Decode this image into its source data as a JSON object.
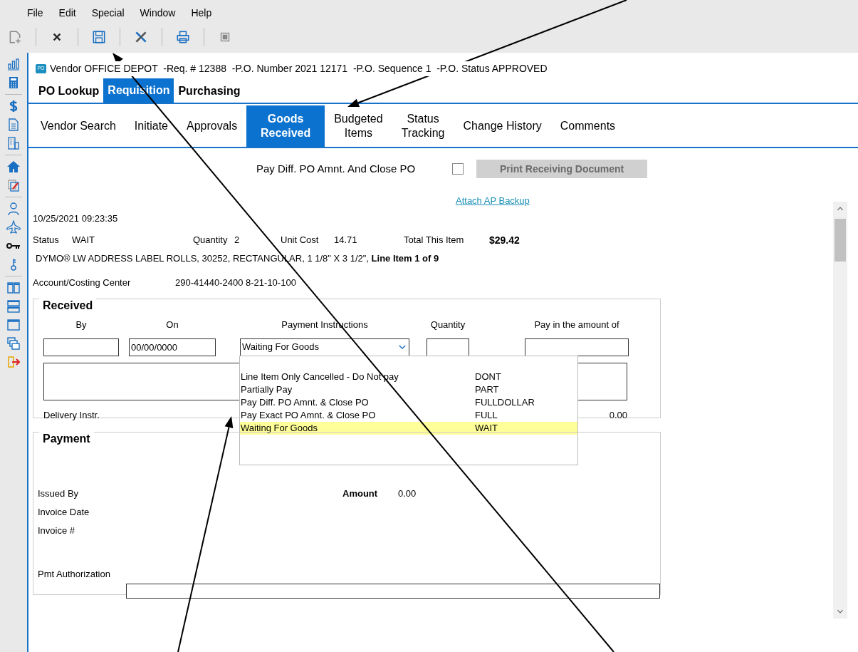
{
  "menu": [
    "File",
    "Edit",
    "Special",
    "Window",
    "Help"
  ],
  "header": {
    "badge": "PO",
    "text": "Vendor OFFICE DEPOT  -Req. # 12388  -P.O. Number 2021 12171  -P.O. Sequence 1  -P.O. Status APPROVED"
  },
  "top_tabs": [
    {
      "label": "PO Lookup",
      "selected": false
    },
    {
      "label": "Requisition",
      "selected": true
    },
    {
      "label": "Purchasing",
      "selected": false
    }
  ],
  "sub_tabs": [
    {
      "lines": [
        "Vendor Search"
      ],
      "selected": false
    },
    {
      "lines": [
        "Initiate"
      ],
      "selected": false
    },
    {
      "lines": [
        "Approvals"
      ],
      "selected": false
    },
    {
      "lines": [
        "Goods",
        "Received"
      ],
      "selected": true
    },
    {
      "lines": [
        "Budgeted",
        "Items"
      ],
      "selected": false
    },
    {
      "lines": [
        "Status",
        "Tracking"
      ],
      "selected": false
    },
    {
      "lines": [
        "Change History"
      ],
      "selected": false
    },
    {
      "lines": [
        "Comments"
      ],
      "selected": false
    }
  ],
  "pay_diff": {
    "label": "Pay Diff. PO Amnt. And Close PO",
    "checked": false
  },
  "print_button": {
    "label": "Print Receiving Document",
    "disabled": true
  },
  "attach_link": "Attach AP Backup",
  "timestamp": "10/25/2021 09:23:35",
  "summary": [
    {
      "label": "Status",
      "value": "WAIT"
    },
    {
      "label": "Quantity",
      "value": "2"
    },
    {
      "label": "Unit Cost",
      "value": "14.71"
    },
    {
      "label": "Total This Item",
      "value": "$29.42"
    }
  ],
  "description": "DYMO® LW ADDRESS LABEL ROLLS, 30252, RECTANGULAR, 1 1/8\" X 3 1/2\", **Line Item 1 of 9**",
  "account": {
    "label": "Account/Costing Center",
    "value": "290-41440-2400  8-21-10-100"
  },
  "received": {
    "title": "Received",
    "columns": [
      "By",
      "On",
      "Payment Instructions",
      "Quantity",
      "Pay in the amount of"
    ],
    "on": "00/00/0000",
    "payment_instructions": "Waiting For Goods",
    "delivery_label": "Delivery Instr.",
    "delivery_amount": "0.00",
    "options": [
      {
        "label": "Line Item Only Cancelled - Do Not pay",
        "code": "DONT",
        "selected": false
      },
      {
        "label": "Partially Pay",
        "code": "PART",
        "selected": false
      },
      {
        "label": "Pay Diff. PO Amnt. & Close PO",
        "code": "FULLDOLLAR",
        "selected": false
      },
      {
        "label": "Pay Exact PO Amnt. & Close PO",
        "code": "FULL",
        "selected": false
      },
      {
        "label": "Waiting For Goods",
        "code": "WAIT",
        "selected": true
      }
    ]
  },
  "payment": {
    "title": "Payment",
    "issued_by": "Issued By",
    "amount_label": "Amount",
    "amount": "0.00",
    "invoice_date": "Invoice Date",
    "invoice_no": "Invoice #",
    "authorization": "Pmt Authorization"
  }
}
